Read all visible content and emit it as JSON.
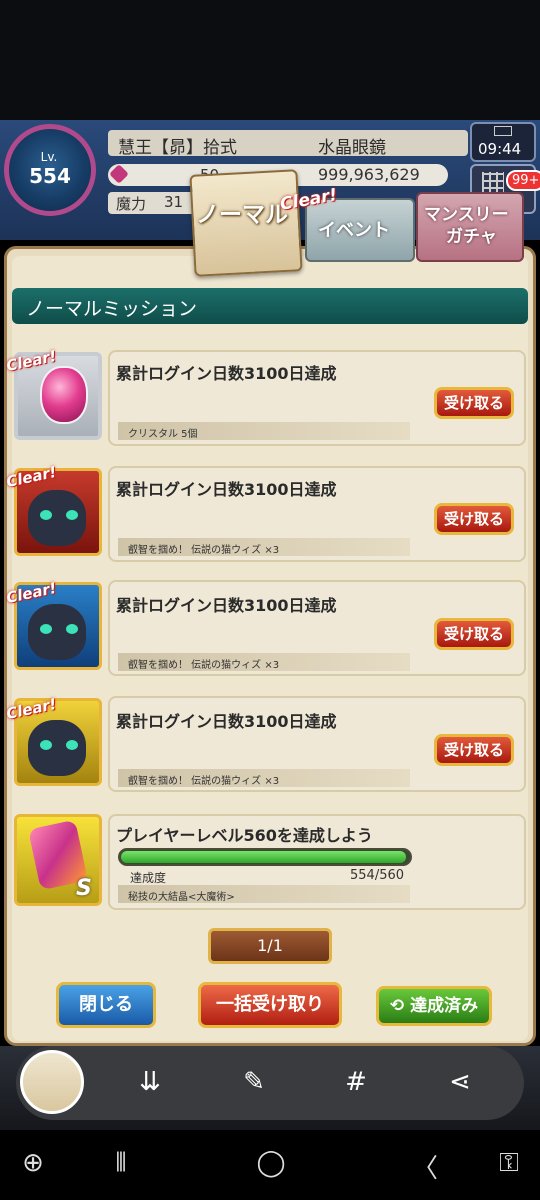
{
  "header": {
    "level_label": "Lv.",
    "level_value": "554",
    "title": "慧王【昴】拾式",
    "name": "水晶眼鏡",
    "crystal_left": "50",
    "crystal_value": "999,963,629",
    "mana_label": "魔力",
    "mana_value": "31",
    "time": "09:44",
    "badge": "99+"
  },
  "tabs": {
    "normal": "ノーマル",
    "clear_tag": "Clear!",
    "event": "イベント",
    "monthly_line1": "マンスリー",
    "monthly_line2": "ガチャ"
  },
  "section_title": "ノーマルミッション",
  "missions": [
    {
      "title": "累計ログイン日数3100日達成",
      "reward": "クリスタル 5個",
      "button": "受け取る",
      "clear": "Clear!",
      "icon": "crystal-reward-icon"
    },
    {
      "title": "累計ログイン日数3100日達成",
      "reward": "叡智を掴め！ 伝説の猫ウィズ ×3",
      "button": "受け取る",
      "clear": "Clear!",
      "icon": "wiz-cat-card-icon"
    },
    {
      "title": "累計ログイン日数3100日達成",
      "reward": "叡智を掴め！ 伝説の猫ウィズ ×3",
      "button": "受け取る",
      "clear": "Clear!",
      "icon": "wiz-cat-card-icon"
    },
    {
      "title": "累計ログイン日数3100日達成",
      "reward": "叡智を掴め！ 伝説の猫ウィズ ×3",
      "button": "受け取る",
      "clear": "Clear!",
      "icon": "wiz-cat-card-icon"
    }
  ],
  "level_mission": {
    "title": "プレイヤーレベル560を達成しよう",
    "progress_label": "達成度",
    "progress_text": "554/560",
    "progress_fraction": 0.989,
    "reward": "秘技の大結晶<大魔術>",
    "rank": "S"
  },
  "page_indicator": "1/1",
  "buttons": {
    "close": "閉じる",
    "claim_all": "一括受け取り",
    "completed": "達成済み"
  },
  "colors": {
    "accent_teal": "#1c6f6a",
    "button_red": "#b11f12",
    "button_blue": "#1a5aa8",
    "button_green": "#2a7d15",
    "progress_green": "#2fa82c"
  }
}
